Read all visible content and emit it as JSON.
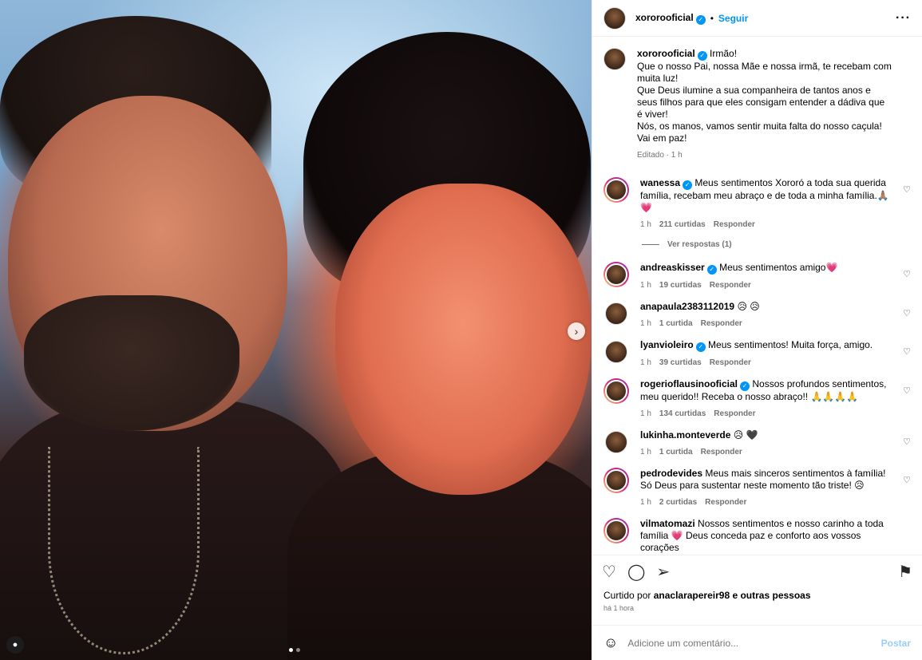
{
  "post": {
    "username": "xororooficial",
    "follow_label": "Seguir",
    "separator": "•",
    "more_icon": "more-horizontal-icon",
    "caption_lines": [
      "Irmão!",
      "Que o nosso Pai, nossa Mãe e nossa irmã, te recebam com muita luz!",
      "Que Deus ilumine a sua companheira de tantos anos e seus filhos para que eles consigam entender a dádiva que é viver!",
      "Nós, os manos, vamos sentir muita falta do nosso caçula!",
      "Vai em paz!"
    ],
    "caption_meta": "Editado · 1 h"
  },
  "comments": [
    {
      "username": "wanessa",
      "verified": true,
      "text": "Meus sentimentos Xororó a toda sua querida família, recebam meu abraço e de toda a minha família.🙏🏽 💗",
      "time": "1 h",
      "likes": "211 curtidas",
      "reply": "Responder",
      "view_replies": "Ver respostas (1)"
    },
    {
      "username": "andreaskisser",
      "verified": true,
      "text": "Meus sentimentos amigo💗",
      "time": "1 h",
      "likes": "19 curtidas",
      "reply": "Responder"
    },
    {
      "username": "anapaula2383112019",
      "verified": false,
      "text": "😥 😥",
      "time": "1 h",
      "likes": "1 curtida",
      "reply": "Responder"
    },
    {
      "username": "lyanvioleiro",
      "verified": true,
      "text": "Meus sentimentos! Muita força, amigo.",
      "time": "1 h",
      "likes": "39 curtidas",
      "reply": "Responder"
    },
    {
      "username": "rogerioflausinooficial",
      "verified": true,
      "text": "Nossos profundos sentimentos, meu querido!! Receba o nosso abraço!! 🙏🙏🙏🙏",
      "time": "1 h",
      "likes": "134 curtidas",
      "reply": "Responder"
    },
    {
      "username": "lukinha.monteverde",
      "verified": false,
      "text": "😥 🖤",
      "time": "1 h",
      "likes": "1 curtida",
      "reply": "Responder"
    },
    {
      "username": "pedrodevides",
      "verified": false,
      "text": "Meus mais sinceros sentimentos à família! Só Deus para sustentar neste momento tão triste! 😥",
      "time": "1 h",
      "likes": "2 curtidas",
      "reply": "Responder"
    },
    {
      "username": "vilmatomazi",
      "verified": false,
      "text": "Nossos sentimentos e nosso carinho a toda família 💗 Deus conceda paz e conforto aos vossos corações",
      "time": "",
      "likes": "",
      "reply": ""
    }
  ],
  "actions": {
    "like_icon": "heart-icon",
    "comment_icon": "comment-icon",
    "share_icon": "send-icon",
    "save_icon": "bookmark-icon",
    "liked_by_prefix": "Curtido por",
    "liked_by_user": "anaclarapereir98",
    "liked_by_suffix": "e outras pessoas",
    "time": "há 1 hora"
  },
  "add_comment": {
    "placeholder": "Adicione um comentário...",
    "post_label": "Postar",
    "emoji_icon": "emoji-icon"
  },
  "colors": {
    "accent": "#0095f6",
    "post_disabled": "#9ccdf6"
  }
}
